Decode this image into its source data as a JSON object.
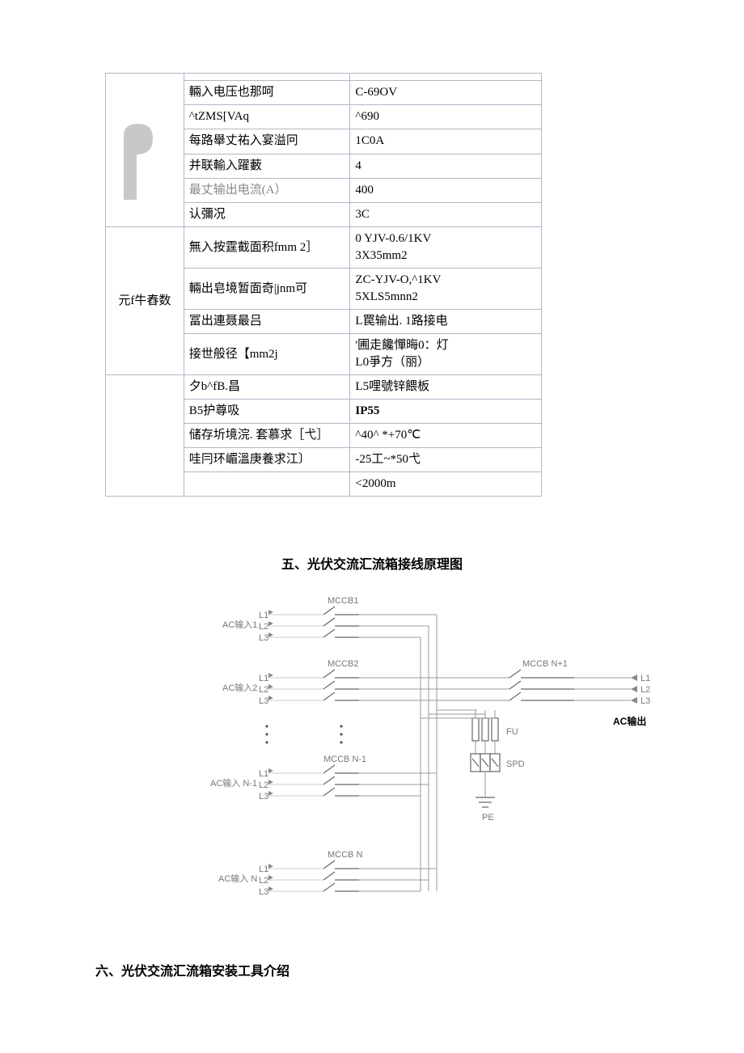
{
  "table": {
    "group_label": "元f牛舂数",
    "rows": [
      {
        "label": "",
        "value": ""
      },
      {
        "label": "輛入电压也那呵",
        "value": "C-69OV"
      },
      {
        "label": "^tZMS[VAq",
        "value": "^690"
      },
      {
        "label": "每路舉丈祐入宴溢冋",
        "value": "1C0A"
      },
      {
        "label": "并联輸入躍藪",
        "value": "4"
      },
      {
        "label": "最丈输出电流(A）",
        "value": "400"
      },
      {
        "label": "认彌况",
        "value": "3C"
      },
      {
        "label": "無入按霆截面积fmm 2］",
        "value": "0 YJV-0.6/1KV\n3X35mm2"
      },
      {
        "label": "輛出皂境暂面奇|jnm可",
        "value": "ZC-YJV-O,^1KV\n5XLS5mnn2"
      },
      {
        "label": "冨出連聂最吕",
        "value": "L罠输出. 1路接电"
      },
      {
        "label": "接世般径【mm2j",
        "value": "'圃走饞憚晦0：灯\nL0爭方（丽）"
      },
      {
        "label": "夕b^fB.昌",
        "value": "L5哩號锌餵板"
      },
      {
        "label": "B5护尊吸",
        "value": "IP55"
      },
      {
        "label": "储存圻境浣. 套慕求［弋］",
        "value": "^40^ *+70℃"
      },
      {
        "label": "哇冃环嵋溫庚養求江〕",
        "value": "-25工~*50弋"
      },
      {
        "label": "",
        "value": "<2000m"
      }
    ]
  },
  "section5": "五、光伏交流汇流箱接线原理图",
  "section6": "六、光伏交流汇流箱安装工具介绍",
  "diagram": {
    "mccb1": "MCCB1",
    "mccb2": "MCCB2",
    "mccb_n_minus_1": "MCCB N-1",
    "mccb_n": "MCCB N",
    "mccb_n_plus_1": "MCCB N+1",
    "ac_in_1": "AC输入1",
    "ac_in_2": "AC输入2",
    "ac_in_n_minus_1": "AC输入 N-1",
    "ac_in_n": "AC输入 N",
    "ac_out": "AC输出",
    "l1": "L1",
    "l2": "L2",
    "l3": "L3",
    "fu": "FU",
    "spd": "SPD",
    "pe": "PE"
  }
}
